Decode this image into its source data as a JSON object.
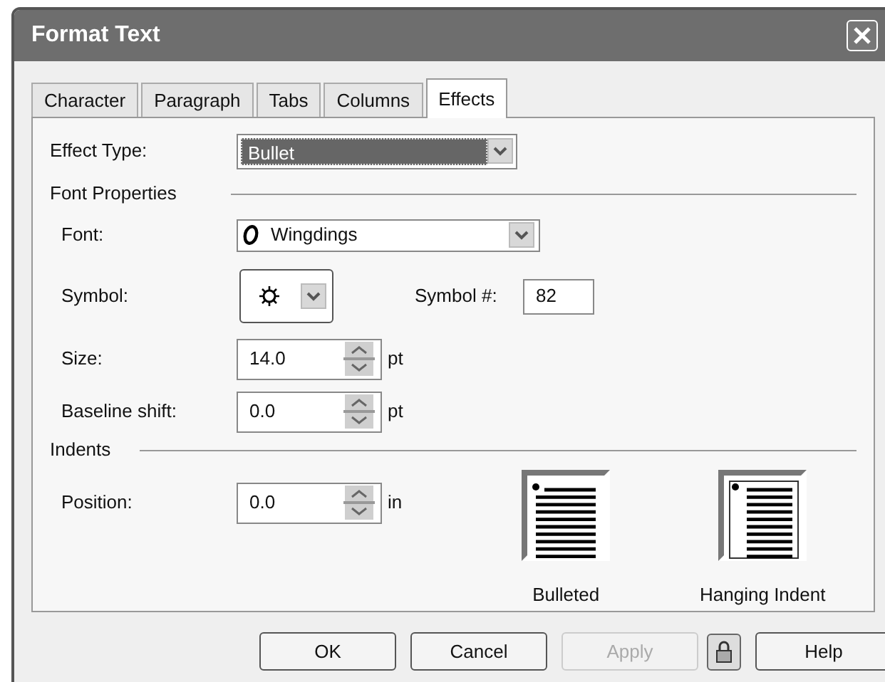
{
  "window": {
    "title": "Format Text"
  },
  "tabs": [
    {
      "label": "Character",
      "selected": false
    },
    {
      "label": "Paragraph",
      "selected": false
    },
    {
      "label": "Tabs",
      "selected": false
    },
    {
      "label": "Columns",
      "selected": false
    },
    {
      "label": "Effects",
      "selected": true
    }
  ],
  "effect_type": {
    "label": "Effect Type:",
    "value": "Bullet"
  },
  "font_properties": {
    "heading": "Font Properties",
    "font": {
      "label": "Font:",
      "value": "Wingdings"
    },
    "symbol": {
      "label": "Symbol:"
    },
    "symbol_number": {
      "label": "Symbol #:",
      "value": "82"
    },
    "size": {
      "label": "Size:",
      "value": "14.0",
      "unit": "pt"
    },
    "baseline_shift": {
      "label": "Baseline shift:",
      "value": "0.0",
      "unit": "pt"
    }
  },
  "indents": {
    "heading": "Indents",
    "position": {
      "label": "Position:",
      "value": "0.0",
      "unit": "in"
    },
    "layouts": [
      {
        "kind": "bulleted",
        "label": "Bulleted"
      },
      {
        "kind": "hanging",
        "label": "Hanging Indent"
      }
    ]
  },
  "buttons": [
    {
      "kind": "text",
      "label": "OK",
      "disabled": false
    },
    {
      "kind": "text",
      "label": "Cancel",
      "disabled": false
    },
    {
      "kind": "text",
      "label": "Apply",
      "disabled": true
    },
    {
      "kind": "lock",
      "disabled": false
    },
    {
      "kind": "text",
      "label": "Help",
      "disabled": false
    }
  ]
}
